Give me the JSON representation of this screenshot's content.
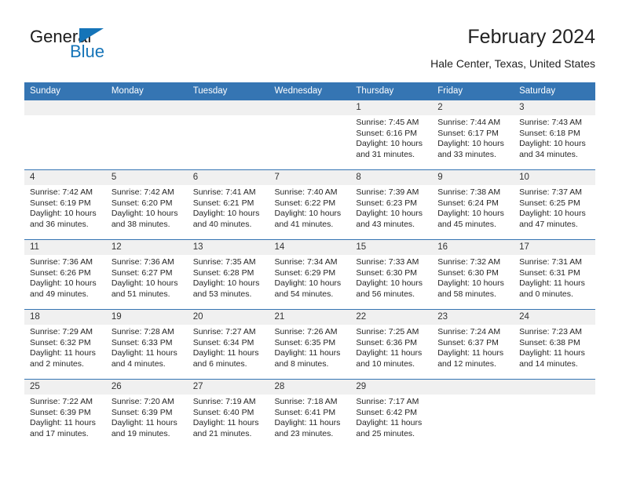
{
  "brand": {
    "name_part1": "General",
    "name_part2": "Blue",
    "triangle_color": "#1574b8"
  },
  "header": {
    "title": "February 2024",
    "subtitle": "Hale Center, Texas, United States"
  },
  "theme": {
    "header_blue": "#3575b3",
    "daynum_band": "#f0f0f0",
    "text": "#262626"
  },
  "calendar": {
    "weekday_headers": [
      "Sunday",
      "Monday",
      "Tuesday",
      "Wednesday",
      "Thursday",
      "Friday",
      "Saturday"
    ],
    "weeks": [
      [
        {
          "day": "",
          "empty": true
        },
        {
          "day": "",
          "empty": true
        },
        {
          "day": "",
          "empty": true
        },
        {
          "day": "",
          "empty": true
        },
        {
          "day": "1",
          "sunrise": "Sunrise: 7:45 AM",
          "sunset": "Sunset: 6:16 PM",
          "daylight": "Daylight: 10 hours and 31 minutes."
        },
        {
          "day": "2",
          "sunrise": "Sunrise: 7:44 AM",
          "sunset": "Sunset: 6:17 PM",
          "daylight": "Daylight: 10 hours and 33 minutes."
        },
        {
          "day": "3",
          "sunrise": "Sunrise: 7:43 AM",
          "sunset": "Sunset: 6:18 PM",
          "daylight": "Daylight: 10 hours and 34 minutes."
        }
      ],
      [
        {
          "day": "4",
          "sunrise": "Sunrise: 7:42 AM",
          "sunset": "Sunset: 6:19 PM",
          "daylight": "Daylight: 10 hours and 36 minutes."
        },
        {
          "day": "5",
          "sunrise": "Sunrise: 7:42 AM",
          "sunset": "Sunset: 6:20 PM",
          "daylight": "Daylight: 10 hours and 38 minutes."
        },
        {
          "day": "6",
          "sunrise": "Sunrise: 7:41 AM",
          "sunset": "Sunset: 6:21 PM",
          "daylight": "Daylight: 10 hours and 40 minutes."
        },
        {
          "day": "7",
          "sunrise": "Sunrise: 7:40 AM",
          "sunset": "Sunset: 6:22 PM",
          "daylight": "Daylight: 10 hours and 41 minutes."
        },
        {
          "day": "8",
          "sunrise": "Sunrise: 7:39 AM",
          "sunset": "Sunset: 6:23 PM",
          "daylight": "Daylight: 10 hours and 43 minutes."
        },
        {
          "day": "9",
          "sunrise": "Sunrise: 7:38 AM",
          "sunset": "Sunset: 6:24 PM",
          "daylight": "Daylight: 10 hours and 45 minutes."
        },
        {
          "day": "10",
          "sunrise": "Sunrise: 7:37 AM",
          "sunset": "Sunset: 6:25 PM",
          "daylight": "Daylight: 10 hours and 47 minutes."
        }
      ],
      [
        {
          "day": "11",
          "sunrise": "Sunrise: 7:36 AM",
          "sunset": "Sunset: 6:26 PM",
          "daylight": "Daylight: 10 hours and 49 minutes."
        },
        {
          "day": "12",
          "sunrise": "Sunrise: 7:36 AM",
          "sunset": "Sunset: 6:27 PM",
          "daylight": "Daylight: 10 hours and 51 minutes."
        },
        {
          "day": "13",
          "sunrise": "Sunrise: 7:35 AM",
          "sunset": "Sunset: 6:28 PM",
          "daylight": "Daylight: 10 hours and 53 minutes."
        },
        {
          "day": "14",
          "sunrise": "Sunrise: 7:34 AM",
          "sunset": "Sunset: 6:29 PM",
          "daylight": "Daylight: 10 hours and 54 minutes."
        },
        {
          "day": "15",
          "sunrise": "Sunrise: 7:33 AM",
          "sunset": "Sunset: 6:30 PM",
          "daylight": "Daylight: 10 hours and 56 minutes."
        },
        {
          "day": "16",
          "sunrise": "Sunrise: 7:32 AM",
          "sunset": "Sunset: 6:30 PM",
          "daylight": "Daylight: 10 hours and 58 minutes."
        },
        {
          "day": "17",
          "sunrise": "Sunrise: 7:31 AM",
          "sunset": "Sunset: 6:31 PM",
          "daylight": "Daylight: 11 hours and 0 minutes."
        }
      ],
      [
        {
          "day": "18",
          "sunrise": "Sunrise: 7:29 AM",
          "sunset": "Sunset: 6:32 PM",
          "daylight": "Daylight: 11 hours and 2 minutes."
        },
        {
          "day": "19",
          "sunrise": "Sunrise: 7:28 AM",
          "sunset": "Sunset: 6:33 PM",
          "daylight": "Daylight: 11 hours and 4 minutes."
        },
        {
          "day": "20",
          "sunrise": "Sunrise: 7:27 AM",
          "sunset": "Sunset: 6:34 PM",
          "daylight": "Daylight: 11 hours and 6 minutes."
        },
        {
          "day": "21",
          "sunrise": "Sunrise: 7:26 AM",
          "sunset": "Sunset: 6:35 PM",
          "daylight": "Daylight: 11 hours and 8 minutes."
        },
        {
          "day": "22",
          "sunrise": "Sunrise: 7:25 AM",
          "sunset": "Sunset: 6:36 PM",
          "daylight": "Daylight: 11 hours and 10 minutes."
        },
        {
          "day": "23",
          "sunrise": "Sunrise: 7:24 AM",
          "sunset": "Sunset: 6:37 PM",
          "daylight": "Daylight: 11 hours and 12 minutes."
        },
        {
          "day": "24",
          "sunrise": "Sunrise: 7:23 AM",
          "sunset": "Sunset: 6:38 PM",
          "daylight": "Daylight: 11 hours and 14 minutes."
        }
      ],
      [
        {
          "day": "25",
          "sunrise": "Sunrise: 7:22 AM",
          "sunset": "Sunset: 6:39 PM",
          "daylight": "Daylight: 11 hours and 17 minutes."
        },
        {
          "day": "26",
          "sunrise": "Sunrise: 7:20 AM",
          "sunset": "Sunset: 6:39 PM",
          "daylight": "Daylight: 11 hours and 19 minutes."
        },
        {
          "day": "27",
          "sunrise": "Sunrise: 7:19 AM",
          "sunset": "Sunset: 6:40 PM",
          "daylight": "Daylight: 11 hours and 21 minutes."
        },
        {
          "day": "28",
          "sunrise": "Sunrise: 7:18 AM",
          "sunset": "Sunset: 6:41 PM",
          "daylight": "Daylight: 11 hours and 23 minutes."
        },
        {
          "day": "29",
          "sunrise": "Sunrise: 7:17 AM",
          "sunset": "Sunset: 6:42 PM",
          "daylight": "Daylight: 11 hours and 25 minutes."
        },
        {
          "day": "",
          "empty": true
        },
        {
          "day": "",
          "empty": true
        }
      ]
    ]
  }
}
